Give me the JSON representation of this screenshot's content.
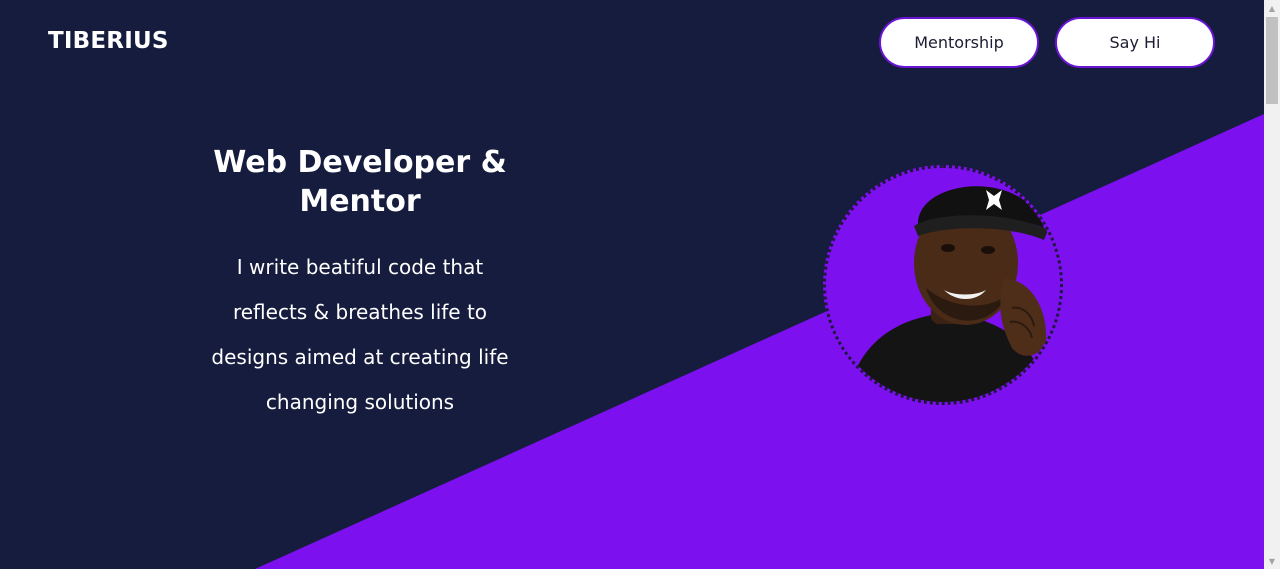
{
  "brand": {
    "logo_text": "TIBERIUS"
  },
  "nav": {
    "items": [
      {
        "label": "Mentorship"
      },
      {
        "label": "Say Hi"
      }
    ]
  },
  "hero": {
    "title": "Web Developer & Mentor",
    "description": "I write beatiful code that reflects & breathes life to designs aimed at creating life changing solutions",
    "avatar_icon": "portrait-photo"
  },
  "colors": {
    "background": "#161c3d",
    "accent": "#7c10ee",
    "button_border": "#6a14d6",
    "button_bg": "#ffffff"
  },
  "scrollbar": {
    "up_icon": "triangle-up",
    "down_icon": "triangle-down"
  }
}
